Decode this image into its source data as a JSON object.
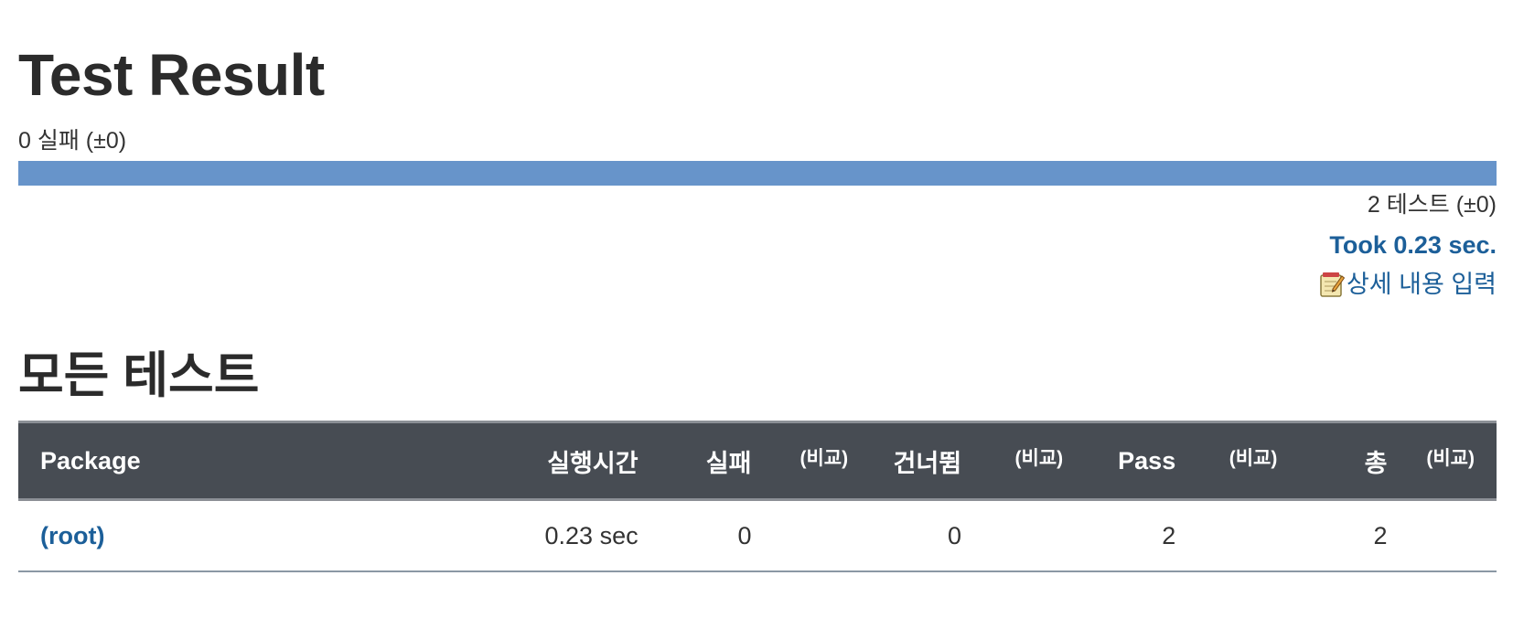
{
  "header": {
    "title": "Test Result",
    "fail_summary": "0 실패 (±0)"
  },
  "result_bar": {
    "pass_fraction": 1.0,
    "color": "#6794ca"
  },
  "summary": {
    "test_count": "2 테스트 (±0)",
    "took": "Took 0.23 sec.",
    "describe_link": "상세 내용 입력",
    "describe_icon": "notepad-icon"
  },
  "section": {
    "title": "모든 테스트"
  },
  "table": {
    "headers": {
      "package": "Package",
      "duration": "실행시간",
      "fail": "실패",
      "fail_diff": "(비교)",
      "skip": "건너뜀",
      "skip_diff": "(비교)",
      "pass": "Pass",
      "pass_diff": "(비교)",
      "total": "총",
      "total_diff": "(비교)"
    },
    "rows": [
      {
        "package": "(root)",
        "duration": "0.23 sec",
        "fail": "0",
        "fail_diff": "",
        "skip": "0",
        "skip_diff": "",
        "pass": "2",
        "pass_diff": "",
        "total": "2",
        "total_diff": ""
      }
    ]
  },
  "colors": {
    "link": "#1c5f99",
    "header_bg": "#474c53",
    "bar": "#6794ca"
  }
}
